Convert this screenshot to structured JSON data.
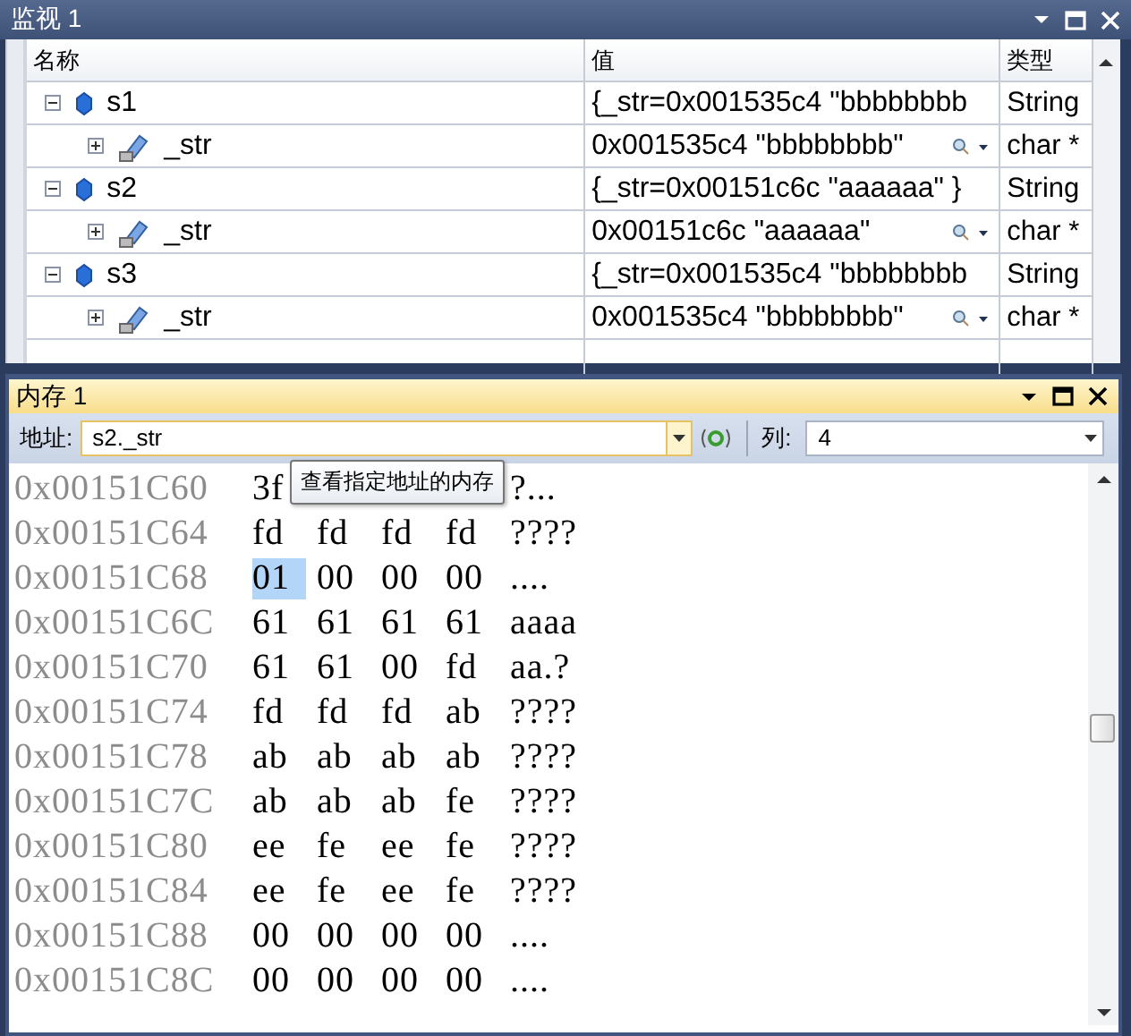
{
  "watch": {
    "title": "监视 1",
    "columns": [
      "名称",
      "值",
      "类型"
    ],
    "rows": [
      {
        "name": "s1",
        "value": "{_str=0x001535c4 \"bbbbbbbb",
        "type": "String",
        "expanded": true,
        "children": [
          {
            "name": "_str",
            "value": "0x001535c4 \"bbbbbbbb\"",
            "type": "char *",
            "expanded": false
          }
        ]
      },
      {
        "name": "s2",
        "value": "{_str=0x00151c6c \"aaaaaa\" }",
        "type": "String",
        "expanded": true,
        "children": [
          {
            "name": "_str",
            "value": "0x00151c6c \"aaaaaa\"",
            "type": "char *",
            "expanded": false
          }
        ]
      },
      {
        "name": "s3",
        "value": "{_str=0x001535c4 \"bbbbbbbb",
        "type": "String",
        "expanded": true,
        "children": [
          {
            "name": "_str",
            "value": "0x001535c4 \"bbbbbbbb\"",
            "type": "char *",
            "expanded": false
          }
        ]
      }
    ]
  },
  "memory": {
    "title": "内存 1",
    "address_label": "地址:",
    "address": "s2._str",
    "columns_label": "列:",
    "columns_value": "4",
    "tooltip": "查看指定地址的内存",
    "rows": [
      {
        "address": "0x00151C60",
        "bytes": [
          {
            "text": "3f",
            "selected": false
          }
        ],
        "ascii": "?..."
      },
      {
        "address": "0x00151C64",
        "bytes": [
          {
            "text": "fd",
            "selected": false
          },
          {
            "text": "fd",
            "selected": false
          },
          {
            "text": "fd",
            "selected": false
          },
          {
            "text": "fd",
            "selected": false
          }
        ],
        "ascii": "????"
      },
      {
        "address": "0x00151C68",
        "bytes": [
          {
            "text": "01",
            "selected": true
          },
          {
            "text": "00",
            "selected": false
          },
          {
            "text": "00",
            "selected": false
          },
          {
            "text": "00",
            "selected": false
          }
        ],
        "ascii": "...."
      },
      {
        "address": "0x00151C6C",
        "bytes": [
          {
            "text": "61",
            "selected": false
          },
          {
            "text": "61",
            "selected": false
          },
          {
            "text": "61",
            "selected": false
          },
          {
            "text": "61",
            "selected": false
          }
        ],
        "ascii": "aaaa"
      },
      {
        "address": "0x00151C70",
        "bytes": [
          {
            "text": "61",
            "selected": false
          },
          {
            "text": "61",
            "selected": false
          },
          {
            "text": "00",
            "selected": false
          },
          {
            "text": "fd",
            "selected": false
          }
        ],
        "ascii": "aa.?"
      },
      {
        "address": "0x00151C74",
        "bytes": [
          {
            "text": "fd",
            "selected": false
          },
          {
            "text": "fd",
            "selected": false
          },
          {
            "text": "fd",
            "selected": false
          },
          {
            "text": "ab",
            "selected": false
          }
        ],
        "ascii": "????"
      },
      {
        "address": "0x00151C78",
        "bytes": [
          {
            "text": "ab",
            "selected": false
          },
          {
            "text": "ab",
            "selected": false
          },
          {
            "text": "ab",
            "selected": false
          },
          {
            "text": "ab",
            "selected": false
          }
        ],
        "ascii": "????"
      },
      {
        "address": "0x00151C7C",
        "bytes": [
          {
            "text": "ab",
            "selected": false
          },
          {
            "text": "ab",
            "selected": false
          },
          {
            "text": "ab",
            "selected": false
          },
          {
            "text": "fe",
            "selected": false
          }
        ],
        "ascii": "????"
      },
      {
        "address": "0x00151C80",
        "bytes": [
          {
            "text": "ee",
            "selected": false
          },
          {
            "text": "fe",
            "selected": false
          },
          {
            "text": "ee",
            "selected": false
          },
          {
            "text": "fe",
            "selected": false
          }
        ],
        "ascii": "????"
      },
      {
        "address": "0x00151C84",
        "bytes": [
          {
            "text": "ee",
            "selected": false
          },
          {
            "text": "fe",
            "selected": false
          },
          {
            "text": "ee",
            "selected": false
          },
          {
            "text": "fe",
            "selected": false
          }
        ],
        "ascii": "????"
      },
      {
        "address": "0x00151C88",
        "bytes": [
          {
            "text": "00",
            "selected": false
          },
          {
            "text": "00",
            "selected": false
          },
          {
            "text": "00",
            "selected": false
          },
          {
            "text": "00",
            "selected": false
          }
        ],
        "ascii": "...."
      },
      {
        "address": "0x00151C8C",
        "bytes": [
          {
            "text": "00",
            "selected": false
          },
          {
            "text": "00",
            "selected": false
          },
          {
            "text": "00",
            "selected": false
          },
          {
            "text": "00",
            "selected": false
          }
        ],
        "ascii": "...."
      }
    ]
  }
}
